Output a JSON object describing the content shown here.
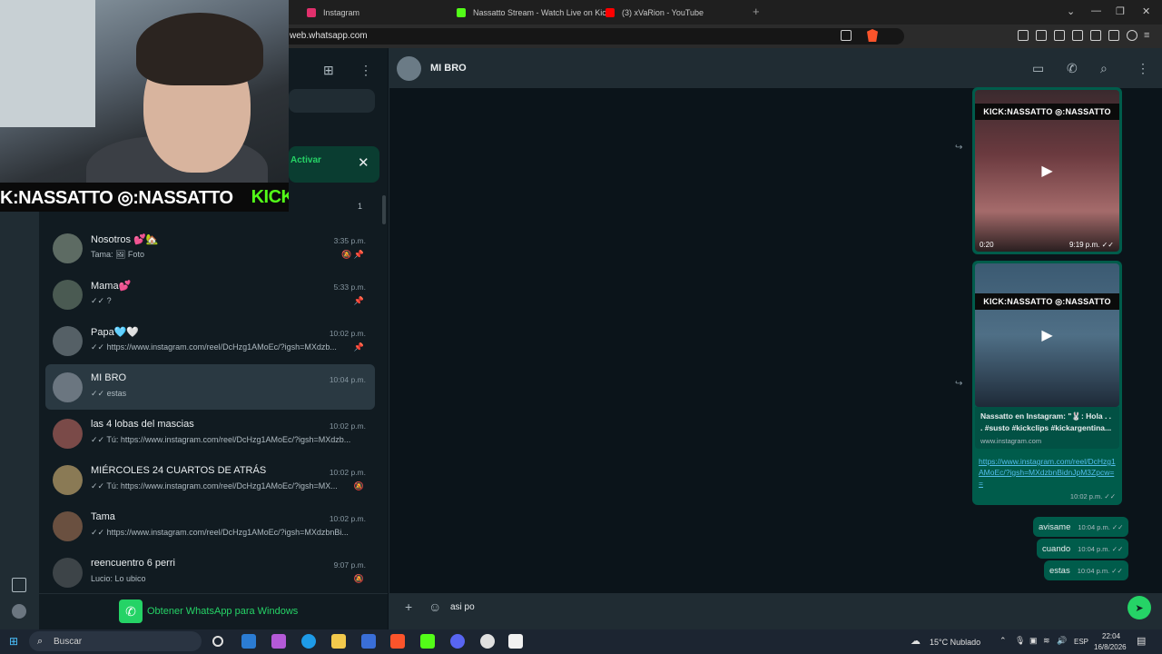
{
  "browser": {
    "tabs": [
      {
        "title": "Instagram",
        "color": "#e1306c"
      },
      {
        "title": "Nassatto Stream - Watch Live on Kick",
        "color": "#53fc18"
      },
      {
        "title": "(3) xVaRion - YouTube",
        "color": "#ff0000"
      }
    ],
    "new_tab": "+",
    "url": "web.whatsapp.com"
  },
  "overlay": {
    "banner_left": "K:NASSATTO ◎:NASSATTO",
    "banner_right": "KICK"
  },
  "sidebar": {
    "banner_action": "Activar",
    "archived_count": "1",
    "chats": [
      {
        "name": "Nosotros 💕🏡",
        "time": "3:35 p.m.",
        "preview": "Tama: 🖼 Foto",
        "meta": "🔕 📌",
        "avatar": "#5d6b63"
      },
      {
        "name": "Mama💕",
        "time": "5:33 p.m.",
        "preview": "✓✓ ?",
        "meta": "📌",
        "avatar": "#4a5a52"
      },
      {
        "name": "Papa🩵🤍",
        "time": "10:02 p.m.",
        "preview": "✓✓ https://www.instagram.com/reel/DcHzg1AMoEc/?igsh=MXdzb...",
        "meta": "📌",
        "avatar": "#556066"
      },
      {
        "name": "MI BRO",
        "time": "10:04 p.m.",
        "preview": "✓✓ estas",
        "meta": "",
        "avatar": "#6b7680"
      },
      {
        "name": "las 4 lobas del mascias",
        "time": "10:02 p.m.",
        "preview": "✓✓ Tú: https://www.instagram.com/reel/DcHzg1AMoEc/?igsh=MXdzb...",
        "meta": "",
        "avatar": "#7a4a48"
      },
      {
        "name": "MIÉRCOLES 24 CUARTOS DE ATRÁS",
        "time": "10:02 p.m.",
        "preview": "✓✓ Tú: https://www.instagram.com/reel/DcHzg1AMoEc/?igsh=MX...",
        "meta": "🔕",
        "avatar": "#8a7a55"
      },
      {
        "name": "Tama",
        "time": "10:02 p.m.",
        "preview": "✓✓ https://www.instagram.com/reel/DcHzg1AMoEc/?igsh=MXdzbnBi...",
        "meta": "",
        "avatar": "#6a5040"
      },
      {
        "name": "reencuentro 6 perri",
        "time": "9:07 p.m.",
        "preview": "Lucio: Lo ubico",
        "meta": "🔕",
        "avatar": "#3d4448"
      }
    ],
    "get_app": "Obtener WhatsApp para Windows"
  },
  "conversation": {
    "contact": "MI BRO",
    "video_message": {
      "strip": "KICK:NASSATTO ◎:NASSATTO",
      "duration": "0:20",
      "time": "9:19 p.m. ✓✓"
    },
    "link_message": {
      "strip": "KICK:NASSATTO ◎:NASSATTO",
      "title": "Nassatto en Instagram: \"🐰: Hola . . . #susto #kickclips #kickargentina...",
      "domain": "www.instagram.com",
      "url": "https://www.instagram.com/reel/DcHzg1AMoEc/?igsh=MXdzbnBidnJpM3Zpcw==",
      "time": "10:02 p.m. ✓✓"
    },
    "messages": [
      {
        "text": "avisame",
        "time": "10:04 p.m. ✓✓"
      },
      {
        "text": "cuando",
        "time": "10:04 p.m. ✓✓"
      },
      {
        "text": "estas",
        "time": "10:04 p.m. ✓✓"
      }
    ],
    "composer_value": "asi po"
  },
  "taskbar": {
    "search": "Buscar",
    "weather": "15°C  Nublado",
    "lang": "ESP",
    "time": "22:04",
    "date": "16/8/2026"
  }
}
